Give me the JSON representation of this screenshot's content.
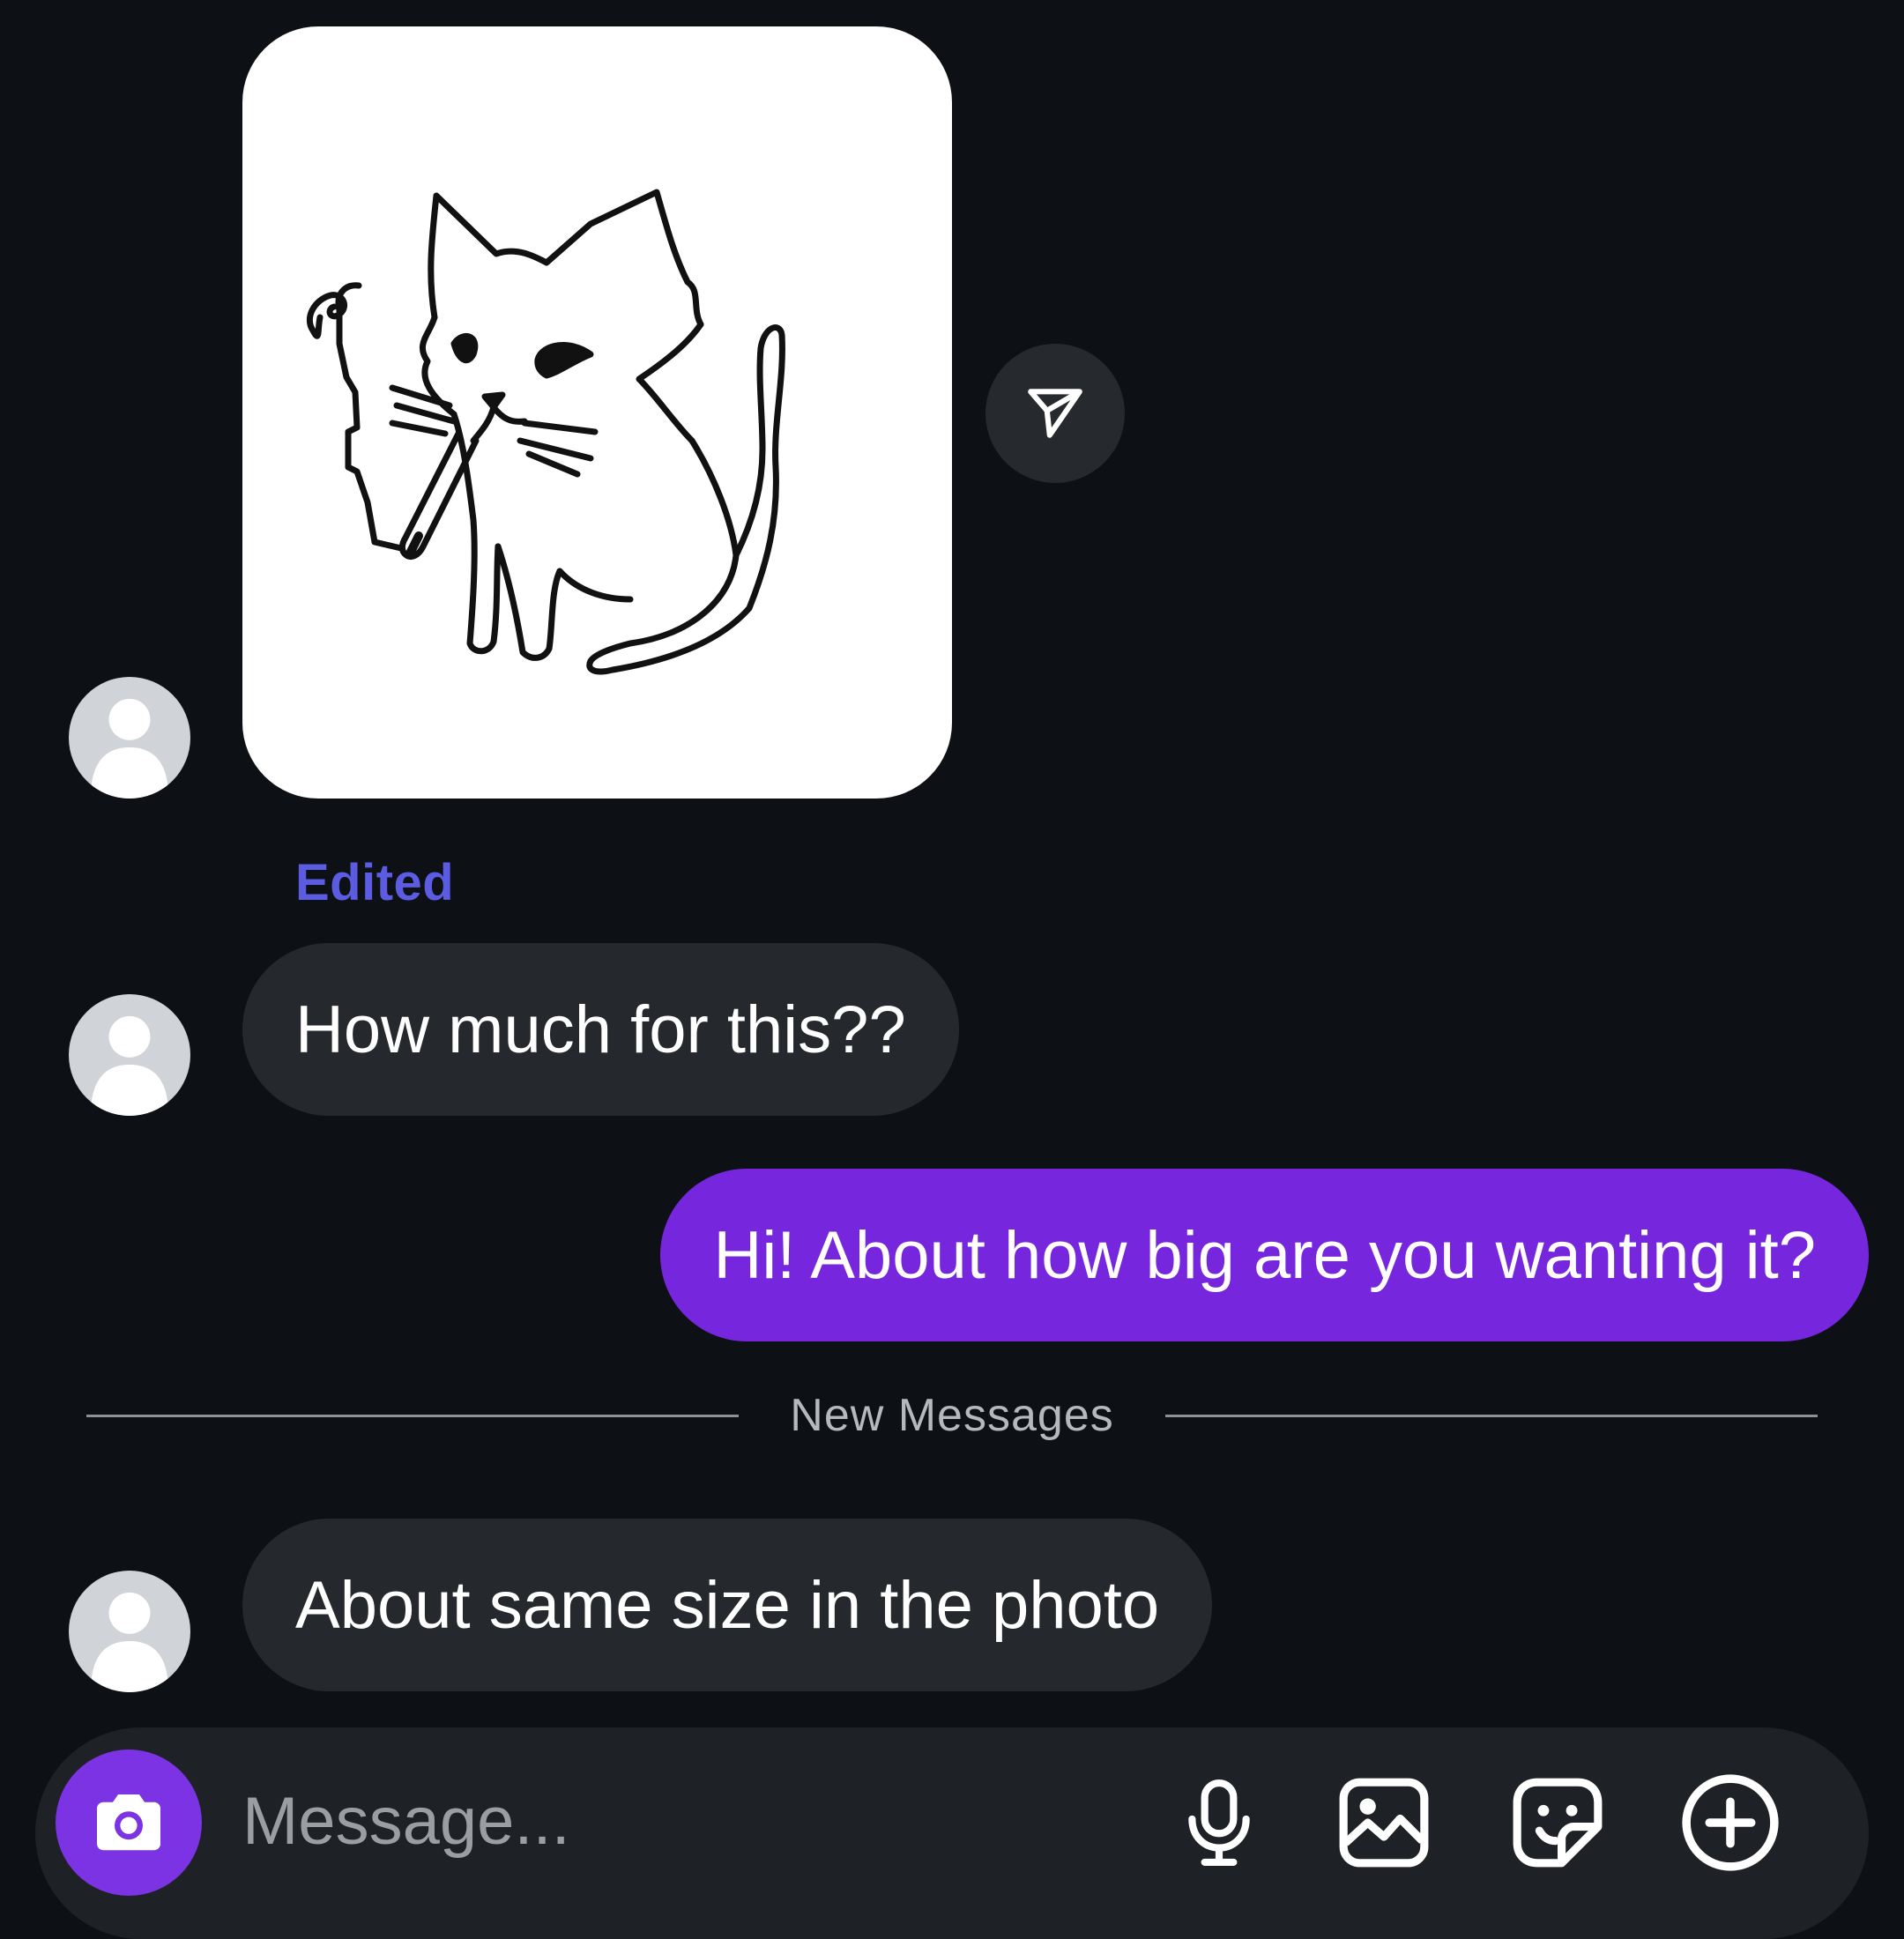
{
  "thread": {
    "edited_label": "Edited",
    "messages": [
      {
        "direction": "incoming",
        "text": "How much for this??"
      },
      {
        "direction": "outgoing",
        "text": "Hi! About how big are you wanting it?"
      },
      {
        "direction": "incoming",
        "text": "About same size in the photo"
      }
    ],
    "divider_label": "New Messages"
  },
  "composer": {
    "placeholder": "Message..."
  },
  "icons": {
    "share": "paper-plane-icon",
    "camera": "camera-icon",
    "mic": "microphone-icon",
    "gallery": "image-icon",
    "sticker": "sticker-icon",
    "more": "plus-circle-icon",
    "avatar": "default-user-silhouette"
  },
  "colors": {
    "background": "#0d1014",
    "incoming_bubble": "#25282c",
    "outgoing_bubble": "#7627de",
    "accent": "#7b33e4",
    "edited_label": "#5b5ce2"
  }
}
